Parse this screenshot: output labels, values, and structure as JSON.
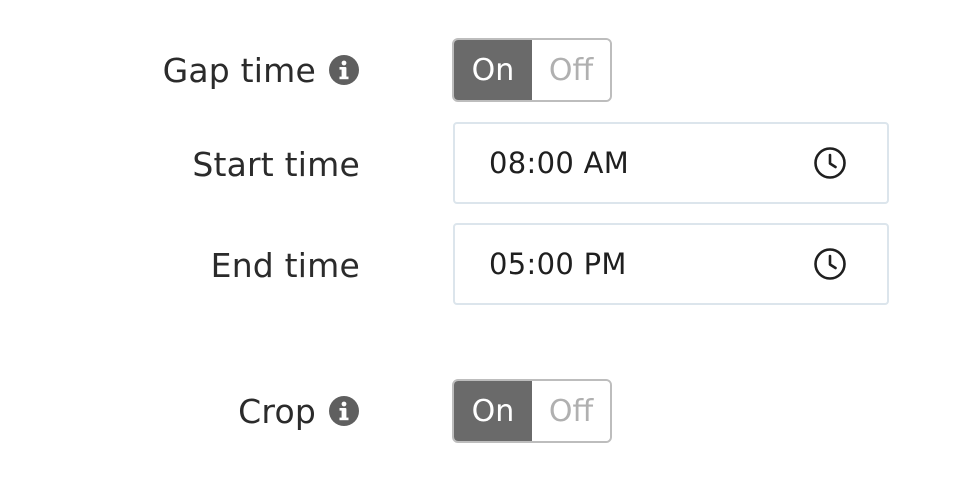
{
  "gap_time": {
    "label": "Gap time",
    "info_icon": "info-circle-icon",
    "toggle": {
      "on_label": "On",
      "off_label": "Off",
      "selected": "On"
    }
  },
  "start_time": {
    "label": "Start time",
    "value": "08:00 AM",
    "icon": "clock-icon"
  },
  "end_time": {
    "label": "End time",
    "value": "05:00 PM",
    "icon": "clock-icon"
  },
  "crop": {
    "label": "Crop",
    "info_icon": "info-circle-icon",
    "toggle": {
      "on_label": "On",
      "off_label": "Off",
      "selected": "On"
    }
  },
  "colors": {
    "toggle_active_bg": "#6a6a6a",
    "toggle_inactive_text": "#b0b0b0",
    "field_border": "#dce5ec",
    "label_text": "#2b2b2b"
  }
}
